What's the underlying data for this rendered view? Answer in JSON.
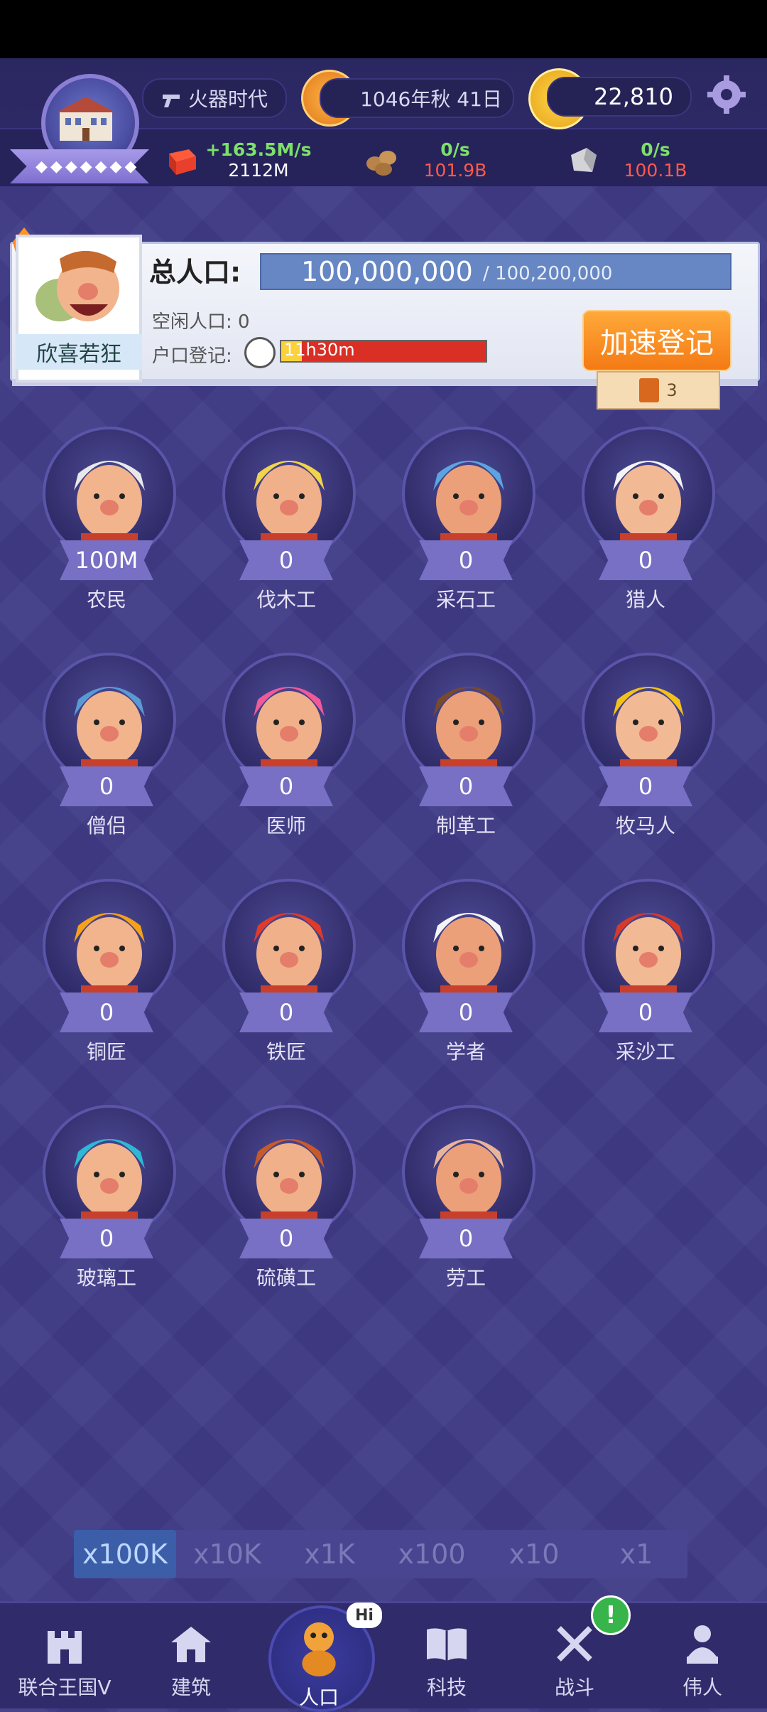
{
  "header": {
    "era": "火器时代",
    "date": "1046年秋 41日",
    "gold": "22,810"
  },
  "resources": [
    {
      "rate": "+163.5M/s",
      "amount": "2112M",
      "icon": "food-icon"
    },
    {
      "rate": "0/s",
      "amount": "101.9B",
      "icon": "wood-icon"
    },
    {
      "rate": "0/s",
      "amount": "100.1B",
      "icon": "stone-icon"
    }
  ],
  "population": {
    "title": "总人口:",
    "mood": "欣喜若狂",
    "current": "100,000,000",
    "max": "/ 100,200,000",
    "idle": "空闲人口: 0",
    "registration_label": "户口登记:",
    "registration_time": "11h30m",
    "registration_progress": 0.1,
    "speed_button": "加速登记",
    "ticket_count": "3"
  },
  "workers": [
    {
      "name": "农民",
      "count": "100M"
    },
    {
      "name": "伐木工",
      "count": "0"
    },
    {
      "name": "采石工",
      "count": "0"
    },
    {
      "name": "猎人",
      "count": "0"
    },
    {
      "name": "僧侣",
      "count": "0"
    },
    {
      "name": "医师",
      "count": "0"
    },
    {
      "name": "制革工",
      "count": "0"
    },
    {
      "name": "牧马人",
      "count": "0"
    },
    {
      "name": "铜匠",
      "count": "0"
    },
    {
      "name": "铁匠",
      "count": "0"
    },
    {
      "name": "学者",
      "count": "0"
    },
    {
      "name": "采沙工",
      "count": "0"
    },
    {
      "name": "玻璃工",
      "count": "0"
    },
    {
      "name": "硫磺工",
      "count": "0"
    },
    {
      "name": "劳工",
      "count": "0"
    }
  ],
  "multipliers": [
    "x100K",
    "x10K",
    "x1K",
    "x100",
    "x10",
    "x1"
  ],
  "multiplier_active": "x100K",
  "nav": [
    {
      "label": "联合王国V",
      "icon": "castle-icon"
    },
    {
      "label": "建筑",
      "icon": "house-icon"
    },
    {
      "label": "人口",
      "icon": "person-icon"
    },
    {
      "label": "科技",
      "icon": "book-icon"
    },
    {
      "label": "战斗",
      "icon": "swords-icon"
    },
    {
      "label": "伟人",
      "icon": "bust-icon"
    }
  ],
  "nav_badges": {
    "hi": "Hi",
    "alert": "!"
  },
  "colors": {
    "accent": "#f47a14",
    "background": "#3f3a86",
    "positive": "#7de06a",
    "negative": "#ff5a4a"
  }
}
